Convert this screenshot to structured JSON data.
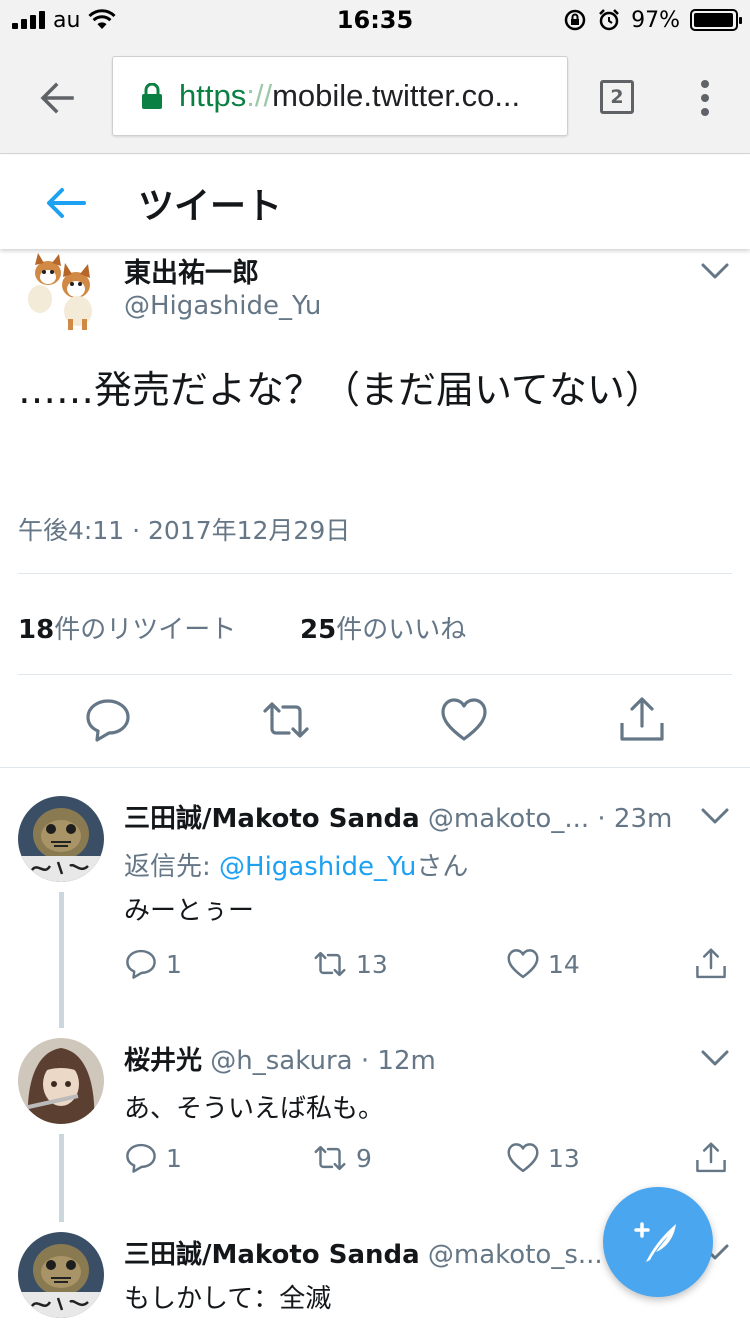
{
  "status_bar": {
    "carrier": "au",
    "time": "16:35",
    "battery_percent": "97%",
    "battery_level": 0.97
  },
  "browser": {
    "url_scheme": "https",
    "url_separator": "://",
    "url_rest": "mobile.twitter.co...",
    "tab_count": "2"
  },
  "header": {
    "title": "ツイート"
  },
  "main_tweet": {
    "author_name": "東出祐一郎",
    "author_handle": "@Higashide_Yu",
    "text": "……発売だよな？（まだ届いてない）",
    "timestamp": "午後4:11 · 2017年12月29日",
    "retweets_count": "18",
    "retweets_label": "件のリツイート",
    "likes_count": "25",
    "likes_label": "件のいいね"
  },
  "replies": [
    {
      "name": "三田誠/Makoto Sanda",
      "handle": "@makoto_...",
      "time": "· 23m",
      "reply_to_prefix": "返信先: ",
      "reply_to_mention": "@Higashide_Yu",
      "reply_to_suffix": "さん",
      "text": "みーとぅー",
      "reply_count": "1",
      "retweet_count": "13",
      "like_count": "14"
    },
    {
      "name": "桜井光",
      "handle": "@h_sakura",
      "time": "· 12m",
      "text": "あ、そういえば私も。",
      "reply_count": "1",
      "retweet_count": "9",
      "like_count": "13"
    },
    {
      "name": "三田誠/Makoto Sanda",
      "handle": "@makoto_s...",
      "text": "もしかして：全滅"
    }
  ],
  "colors": {
    "twitter_blue": "#1da1f2",
    "fab_blue": "#4aa6ee",
    "secure_green": "#0b8043",
    "muted_text": "#657786"
  }
}
